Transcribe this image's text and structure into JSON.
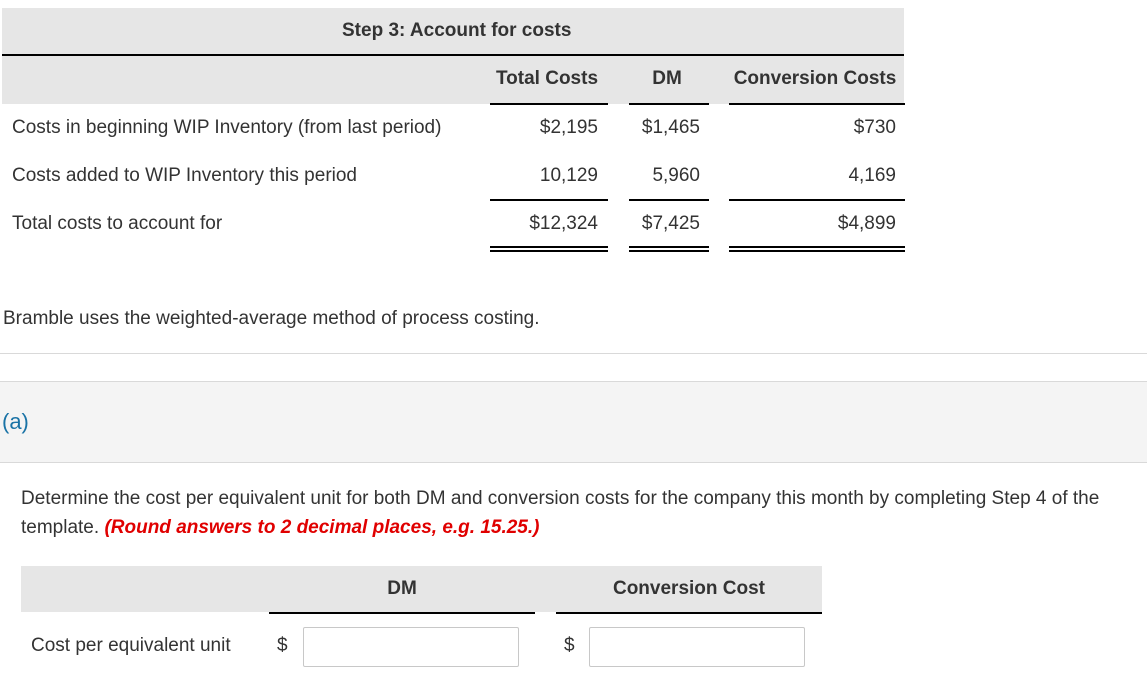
{
  "step3": {
    "title": "Step 3: Account for costs",
    "columns": [
      "Total Costs",
      "DM",
      "Conversion Costs"
    ],
    "rows": [
      {
        "label": "Costs in beginning WIP Inventory (from last period)",
        "total": "$2,195",
        "dm": "$1,465",
        "conversion": "$730"
      },
      {
        "label": "Costs added to WIP Inventory this period",
        "total": "10,129",
        "dm": "5,960",
        "conversion": "4,169"
      },
      {
        "label": "Total costs to account for",
        "total": "$12,324",
        "dm": "$7,425",
        "conversion": "$4,899"
      }
    ]
  },
  "note": "Bramble uses the weighted-average method of process costing.",
  "part": {
    "label": "(a)",
    "question": "Determine the cost per equivalent unit for both DM and conversion costs for the company this month by completing Step 4 of the template.",
    "instruction": "(Round answers to 2 decimal places, e.g. 15.25.)"
  },
  "answer_table": {
    "columns": [
      "DM",
      "Conversion Cost"
    ],
    "row_label": "Cost per equivalent unit",
    "currency_symbol": "$",
    "inputs": {
      "dm": {
        "value": ""
      },
      "conversion": {
        "value": ""
      }
    }
  },
  "colors": {
    "header_bg": "#e6e6e6",
    "part_band_bg": "#f4f4f4",
    "part_label": "#1a73a6",
    "instruction_red": "#e00000",
    "text": "#333333"
  }
}
